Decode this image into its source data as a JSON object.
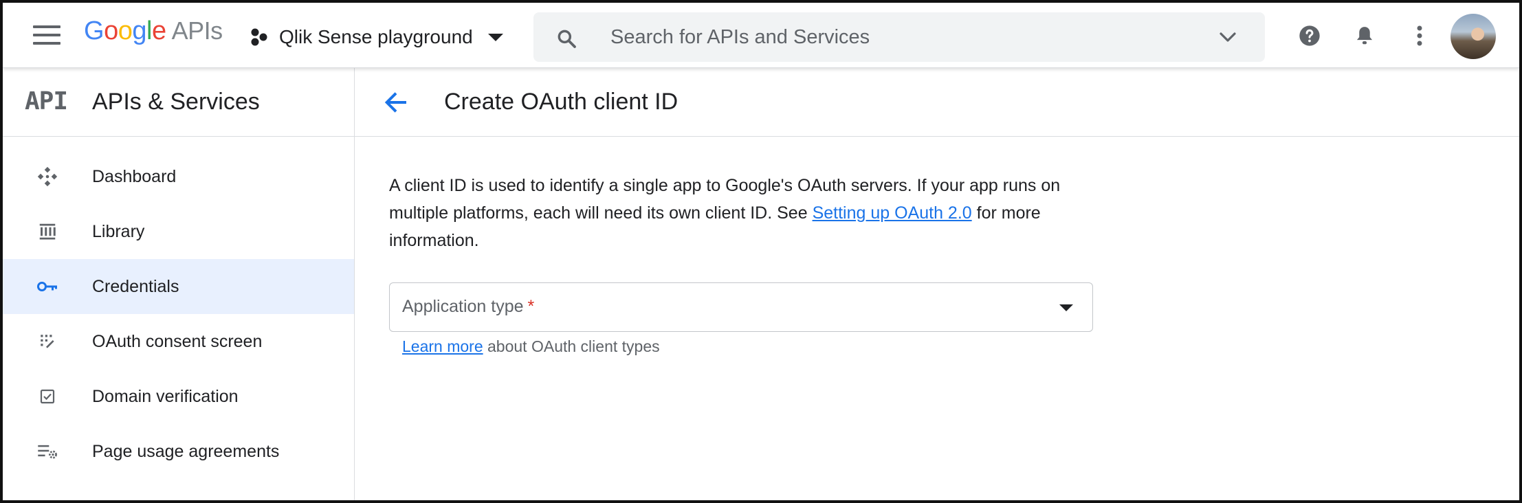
{
  "topbar": {
    "logo_letters": [
      "G",
      "o",
      "o",
      "g",
      "l",
      "e"
    ],
    "logo_suffix": "APIs",
    "project_name": "Qlik Sense playground",
    "search_placeholder": "Search for APIs and Services",
    "icons": {
      "menu": "hamburger-menu-icon",
      "project": "project-hexagon-icon",
      "project_dropdown": "caret-down-icon",
      "search": "search-icon",
      "search_expand": "chevron-down-icon",
      "help": "help-icon",
      "notifications": "bell-icon",
      "more": "more-vert-icon"
    }
  },
  "sidebar": {
    "badge": "API",
    "title": "APIs & Services",
    "items": [
      {
        "label": "Dashboard",
        "icon": "dashboard-icon",
        "active": false
      },
      {
        "label": "Library",
        "icon": "library-icon",
        "active": false
      },
      {
        "label": "Credentials",
        "icon": "key-icon",
        "active": true
      },
      {
        "label": "OAuth consent screen",
        "icon": "consent-grid-icon",
        "active": false
      },
      {
        "label": "Domain verification",
        "icon": "checkbox-icon",
        "active": false
      },
      {
        "label": "Page usage agreements",
        "icon": "settings-list-icon",
        "active": false
      }
    ]
  },
  "main": {
    "title": "Create OAuth client ID",
    "description_part1": "A client ID is used to identify a single app to Google's OAuth servers. If your app runs on multiple platforms, each will need its own client ID. See ",
    "description_link": "Setting up OAuth 2.0",
    "description_part2": " for more information.",
    "application_type_label": "Application type",
    "required_marker": "*",
    "hint_link": "Learn more",
    "hint_text": " about OAuth client types"
  },
  "colors": {
    "accent": "#1a73e8",
    "active_nav_bg": "#e8f0fe",
    "required": "#d93025",
    "icon_gray": "#5f6368"
  }
}
